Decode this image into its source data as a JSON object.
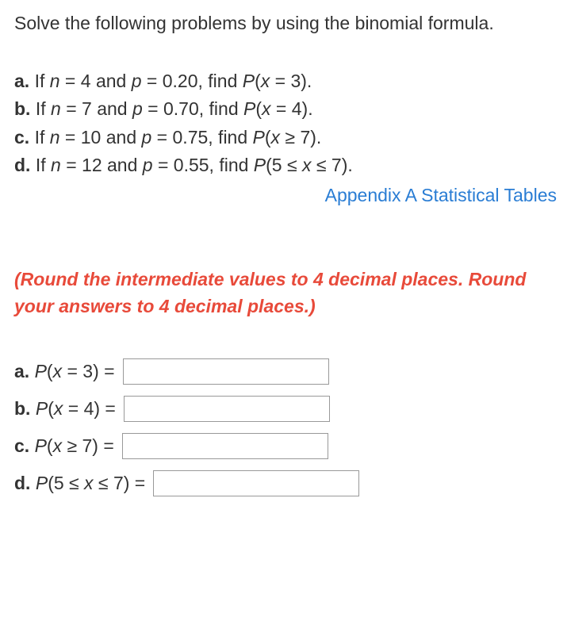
{
  "intro": "Solve the following problems by using the binomial formula.",
  "problems": {
    "a": {
      "label": "a.",
      "text": "If n = 4 and p = 0.20, find P(x = 3)."
    },
    "b": {
      "label": "b.",
      "text": "If n = 7 and p = 0.70, find P(x = 4)."
    },
    "c": {
      "label": "c.",
      "text": "If n = 10 and p = 0.75, find P(x ≥ 7)."
    },
    "d": {
      "label": "d.",
      "text": "If n = 12 and p = 0.55, find P(5 ≤ x ≤ 7)."
    }
  },
  "appendix_link": "Appendix A Statistical Tables",
  "instructions": "(Round the intermediate values to 4 decimal places. Round your answers to 4 decimal places.)",
  "answers": {
    "a": {
      "label": "a.",
      "formula": "P(x = 3) =",
      "value": ""
    },
    "b": {
      "label": "b.",
      "formula": "P(x = 4) =",
      "value": ""
    },
    "c": {
      "label": "c.",
      "formula": "P(x ≥ 7) =",
      "value": ""
    },
    "d": {
      "label": "d.",
      "formula": "P(5 ≤ x ≤ 7) =",
      "value": ""
    }
  }
}
